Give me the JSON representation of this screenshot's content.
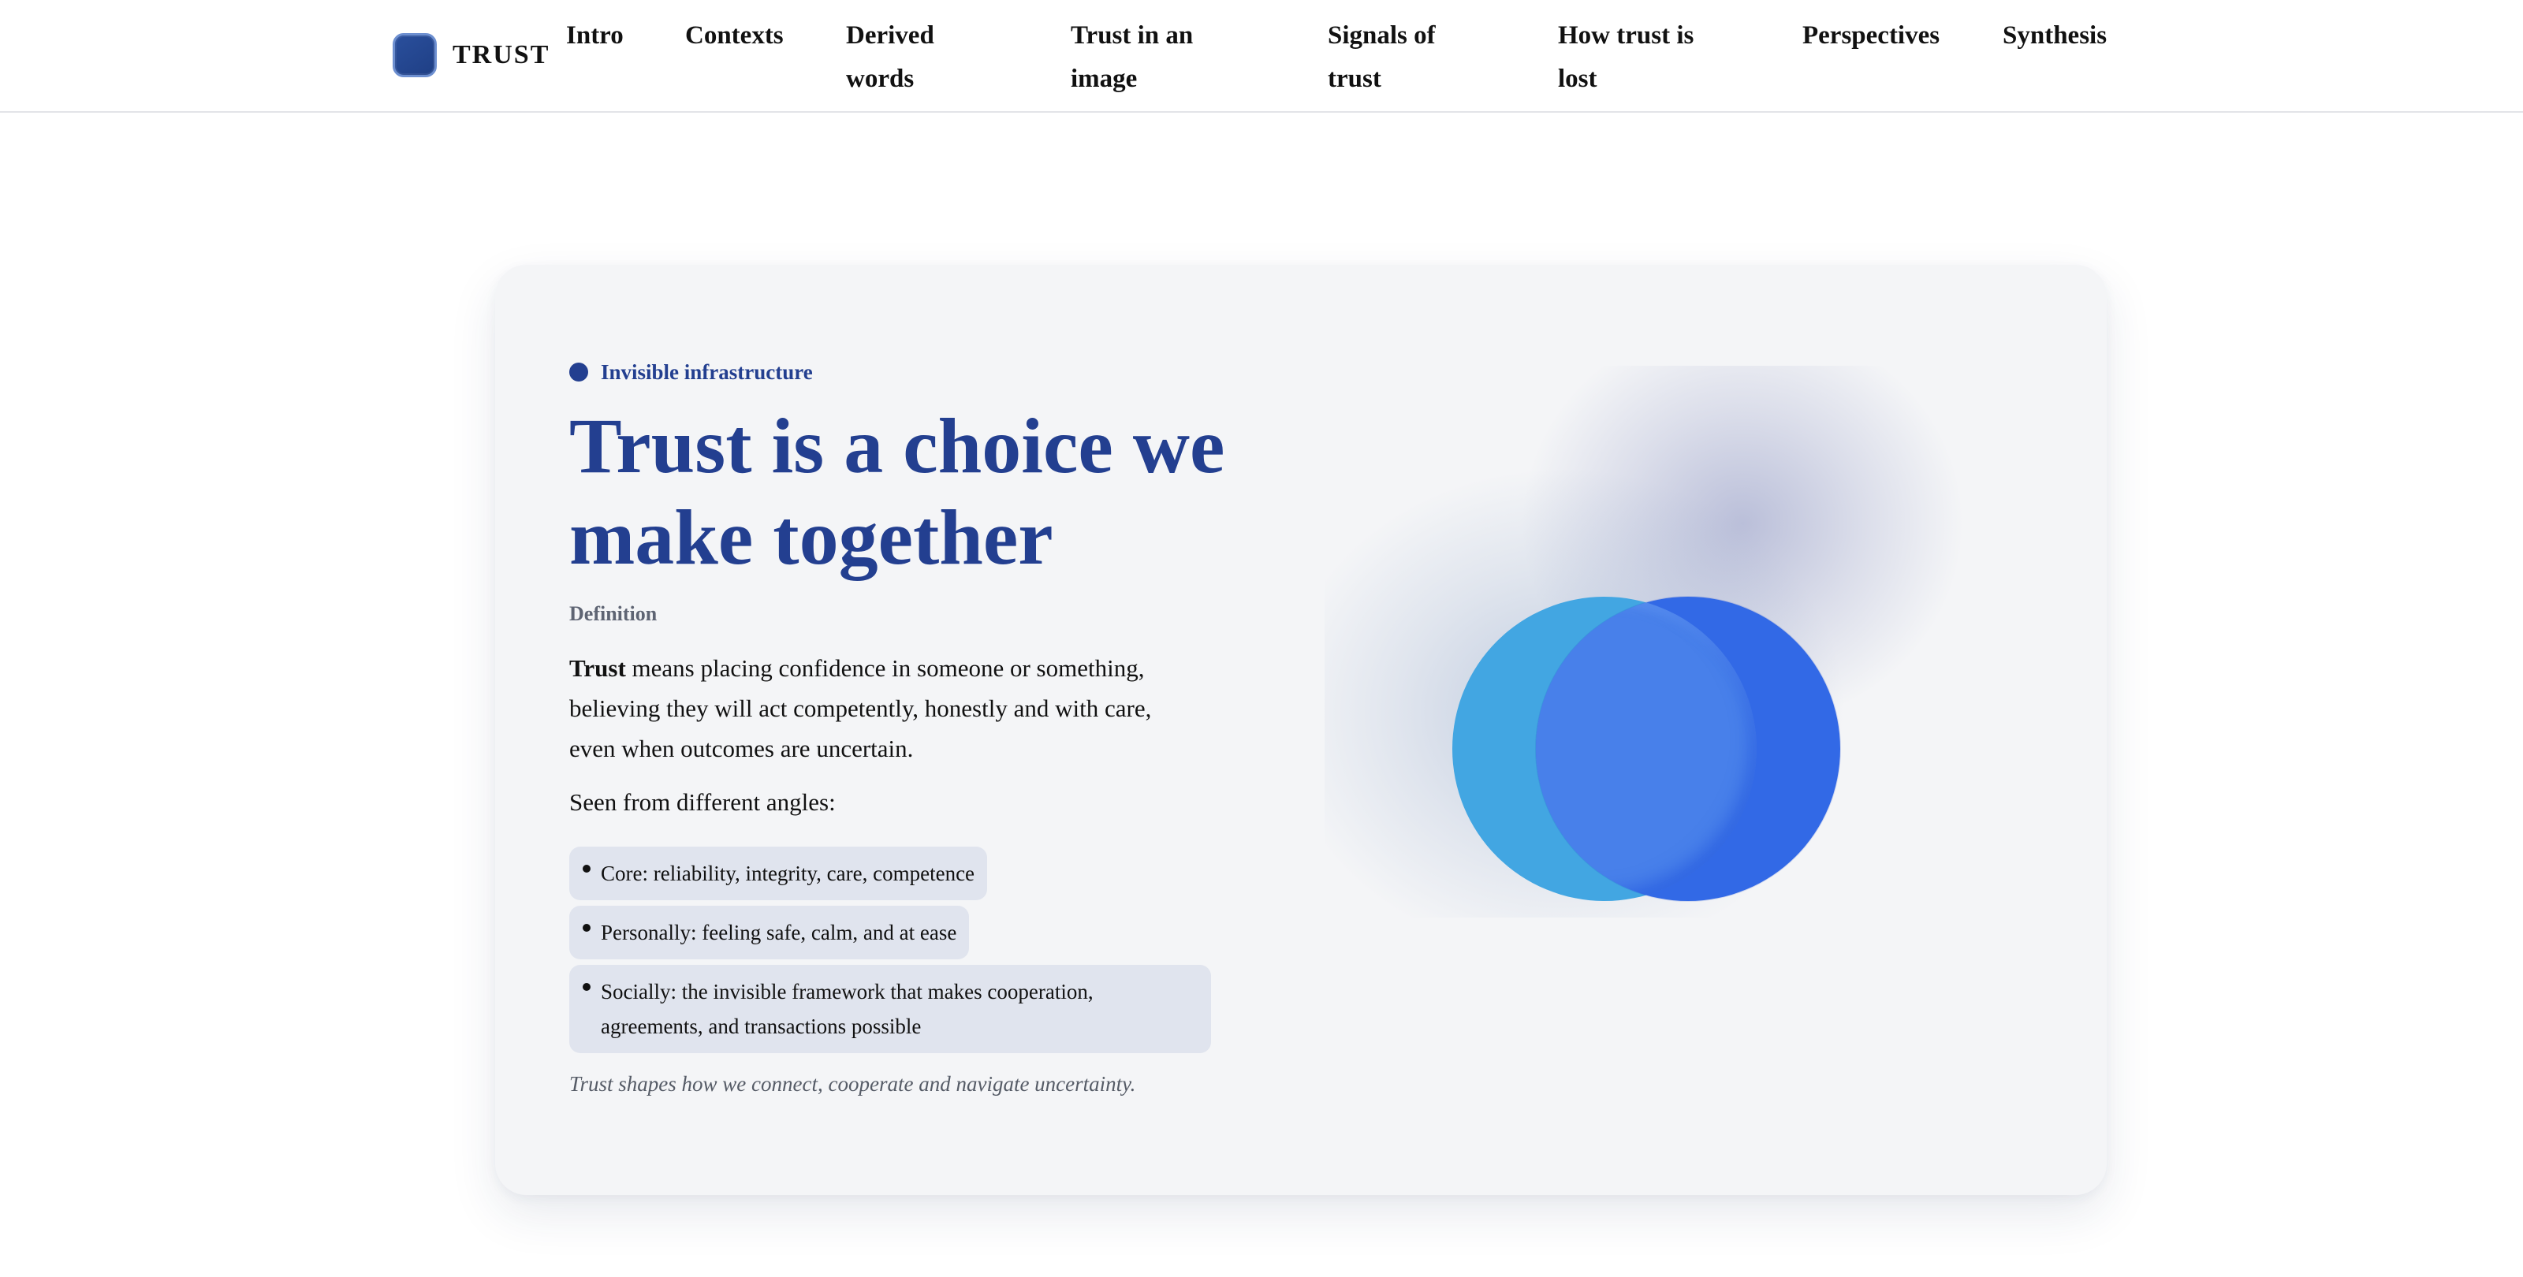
{
  "brand": {
    "name": "TRUST"
  },
  "nav": {
    "items": [
      {
        "label": "Intro"
      },
      {
        "label": "Contexts"
      },
      {
        "label": "Derived words"
      },
      {
        "label": "Trust in an image"
      },
      {
        "label": "Signals of trust"
      },
      {
        "label": "How trust is lost"
      },
      {
        "label": "Perspectives"
      },
      {
        "label": "Synthesis"
      }
    ]
  },
  "hero": {
    "kicker": "Invisible infrastructure",
    "title": "Trust is a choice we make together",
    "definition_label": "Definition",
    "definition_term": "Trust",
    "definition_text": " means placing confidence in someone or something, believing they will act competently, honestly and with care, even when outcomes are uncertain.",
    "angles_intro": "Seen from different angles:",
    "angles": [
      "Core: reliability, integrity, care, competence",
      "Personally: feeling safe, calm, and at ease",
      "Socially: the invisible framework that makes cooperation, agreements, and transactions possible"
    ],
    "footnote": "Trust shapes how we connect, cooperate and navigate uncertainty."
  },
  "colors": {
    "accent": "#233f90",
    "card_bg": "#f4f5f7",
    "pill_bg": "#e0e4ee",
    "circle_left": "#42a6e2",
    "circle_right": "#3269e6"
  }
}
